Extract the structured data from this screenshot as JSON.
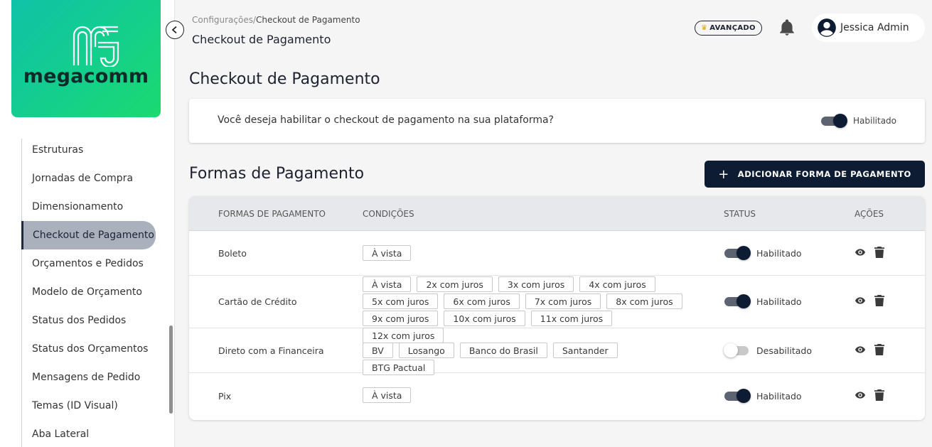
{
  "brand": {
    "name": "megacomm",
    "gradient_start": "#10c2a8",
    "gradient_end": "#1ada6f"
  },
  "sidebar": {
    "items": [
      {
        "label": "Estruturas",
        "active": false
      },
      {
        "label": "Jornadas de Compra",
        "active": false
      },
      {
        "label": "Dimensionamento",
        "active": false
      },
      {
        "label": "Checkout de Pagamento",
        "active": true
      },
      {
        "label": "Orçamentos e Pedidos",
        "active": false
      },
      {
        "label": "Modelo de Orçamento",
        "active": false
      },
      {
        "label": "Status dos Pedidos",
        "active": false
      },
      {
        "label": "Status dos Orçamentos",
        "active": false
      },
      {
        "label": "Mensagens de Pedido",
        "active": false
      },
      {
        "label": "Temas (ID Visual)",
        "active": false
      },
      {
        "label": "Aba Lateral",
        "active": false
      }
    ],
    "collapse_icon": "chevron-left-icon"
  },
  "header": {
    "breadcrumb": {
      "parent": "Configurações",
      "separator": "/",
      "current": "Checkout de Pagamento"
    },
    "title": "Checkout de Pagamento",
    "plan_badge": "AVANÇADO",
    "plan_icon": "crown-icon",
    "notification_icon": "bell-icon",
    "user": {
      "name": "Jessica Admin",
      "icon": "account-circle-icon"
    }
  },
  "checkout": {
    "heading": "Checkout de Pagamento",
    "question": "Você deseja habilitar o checkout de pagamento na sua plataforma?",
    "enabled": true,
    "status_label": "Habilitado"
  },
  "payments": {
    "heading": "Formas de Pagamento",
    "add_button": "ADICIONAR FORMA DE PAGAMENTO",
    "columns": {
      "method": "FORMAS DE PAGAMENTO",
      "conditions": "CONDIÇÕES",
      "status": "STATUS",
      "actions": "AÇÕES"
    },
    "rows": [
      {
        "name": "Boleto",
        "conditions": [
          "À vista"
        ],
        "enabled": true,
        "status_label": "Habilitado"
      },
      {
        "name": "Cartão de Crédito",
        "conditions": [
          "À vista",
          "2x com juros",
          "3x com juros",
          "4x com juros",
          "5x com juros",
          "6x com juros",
          "7x com juros",
          "8x com juros",
          "9x com juros",
          "10x com juros",
          "11x com juros",
          "12x com juros"
        ],
        "enabled": true,
        "status_label": "Habilitado"
      },
      {
        "name": "Direto com a Financeira",
        "conditions": [
          "BV",
          "Losango",
          "Banco do Brasil",
          "Santander",
          "BTG Pactual"
        ],
        "enabled": false,
        "status_label": "Desabilitado"
      },
      {
        "name": "Pix",
        "conditions": [
          "À vista"
        ],
        "enabled": true,
        "status_label": "Habilitado"
      }
    ],
    "row_action_icons": [
      "eye-icon",
      "trash-icon"
    ]
  },
  "colors": {
    "primary": "#0d1b33",
    "toggle_on_track": "#5c6371",
    "toggle_off_track": "#c9c9c9",
    "active_menu": "#aab1bd"
  }
}
